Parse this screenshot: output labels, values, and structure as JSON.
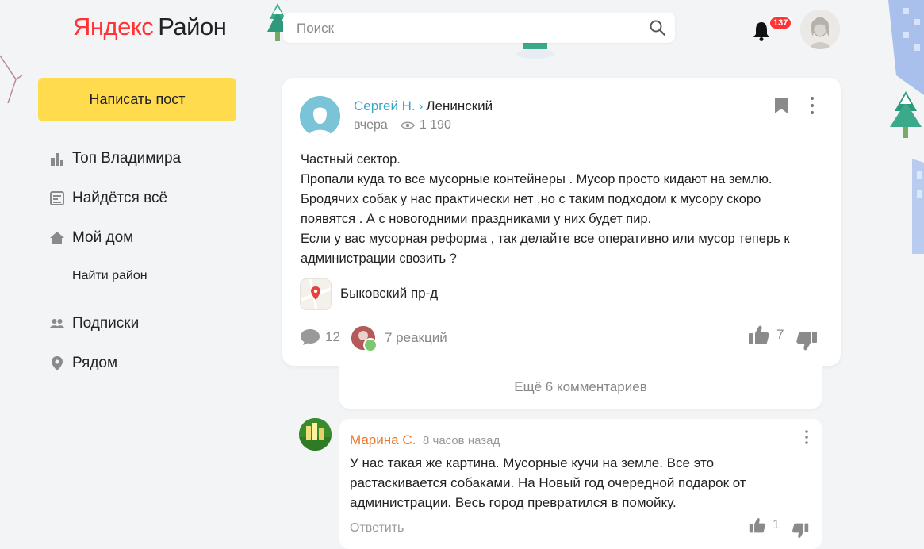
{
  "header": {
    "logo_part1": "Яндекс",
    "logo_part2": "Район",
    "search_placeholder": "Поиск",
    "notification_count": "137"
  },
  "sidebar": {
    "write_post": "Написать пост",
    "items": [
      {
        "label": "Топ Владимира",
        "icon": "city-icon"
      },
      {
        "label": "Найдётся всё",
        "icon": "board-icon"
      },
      {
        "label": "Мой дом",
        "icon": "home-icon"
      },
      {
        "label": "Найти район",
        "icon": ""
      },
      {
        "label": "Подписки",
        "icon": "people-icon"
      },
      {
        "label": "Рядом",
        "icon": "pin-icon"
      }
    ]
  },
  "post": {
    "author": "Сергей Н.",
    "separator": "›",
    "district": "Ленинский",
    "time": "вчера",
    "views": "1 190",
    "text_lines": [
      "Частный сектор.",
      "Пропали куда то все мусорные контейнеры . Мусор просто кидают на землю.",
      "Бродячих собак у нас практически нет ,но с таким подходом к мусору скоро",
      "появятся . А с новогодними праздниками у них будет пир.",
      "Если у вас мусорная реформа , так делайте все оперативно или мусор теперь к",
      "администрации свозить ?"
    ],
    "location": "Быковский пр-д",
    "comments_count": "12",
    "reactions": "7 реакций",
    "likes": "7"
  },
  "more_comments": "Ещё 6 комментариев",
  "comment": {
    "author": "Марина С.",
    "time": "8 часов назад",
    "text_lines": [
      "У нас такая же картина. Мусорные кучи на земле. Все это",
      "растаскивается собаками. На Новый год очередной подарок от",
      "администрации. Весь город превратился в помойку."
    ],
    "reply": "Ответить",
    "likes": "1"
  },
  "colors": {
    "accent_yellow": "#ffdb4d",
    "link_blue": "#3aa7c9",
    "comment_author": "#e8742b",
    "badge_red": "#ff3333"
  }
}
